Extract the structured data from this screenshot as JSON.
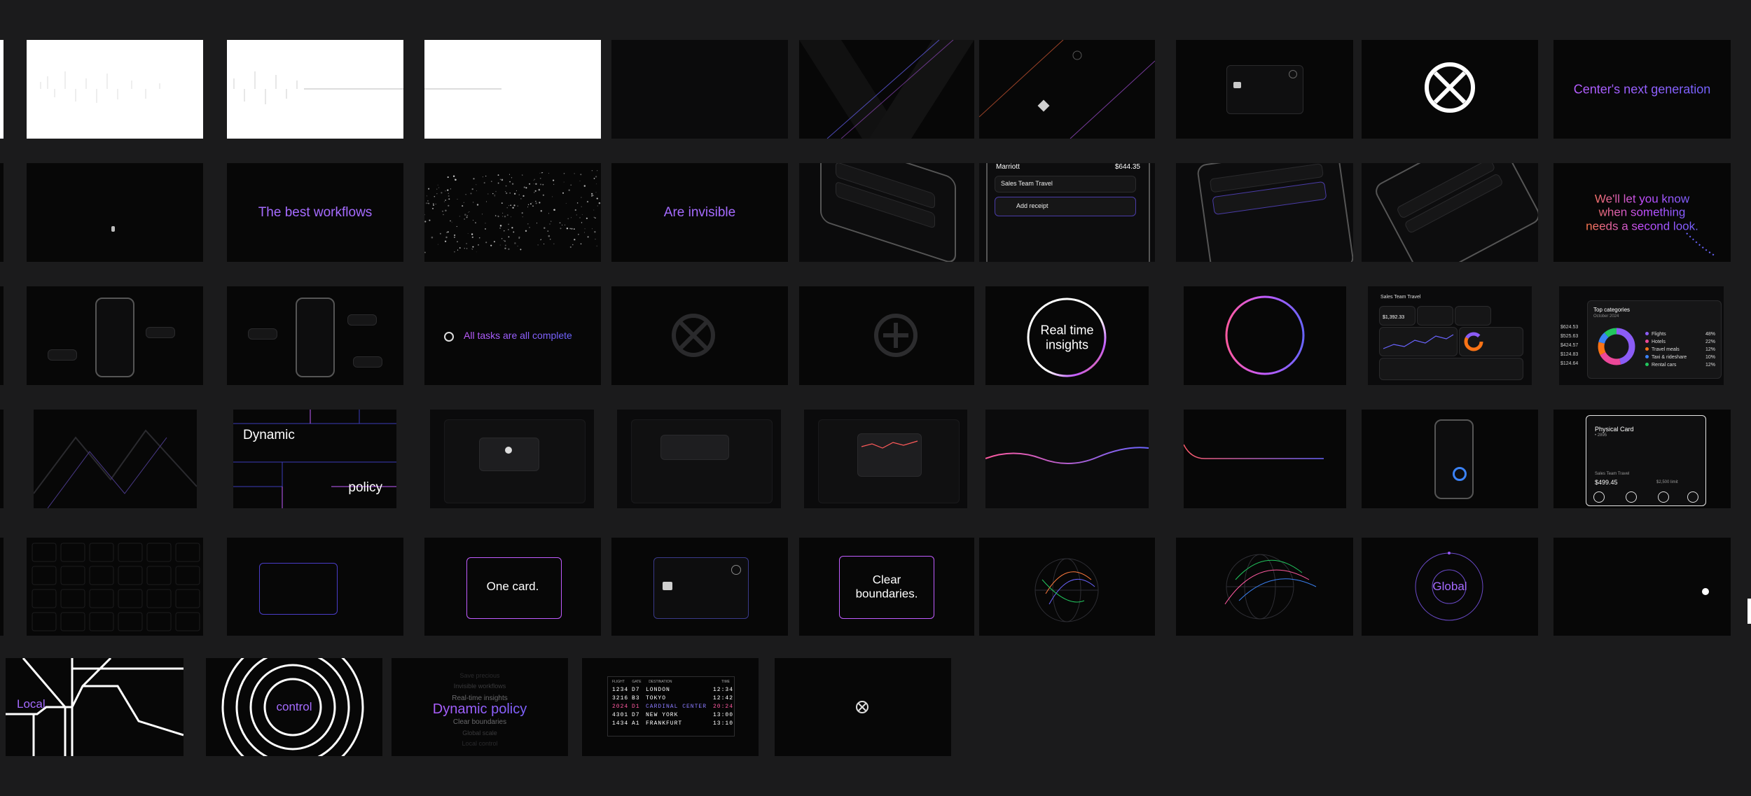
{
  "row1": {
    "headline": "Center's next generation"
  },
  "row2": {
    "best_workflows": "The best workflows",
    "are_invisible": "Are invisible",
    "let_you_know": "We'll let you know when something needs a second look.",
    "phone_amount": "$644.35",
    "phone_merchant": "Marriott",
    "phone_label_sales": "Sales Team Travel",
    "phone_add_receipt": "Add receipt"
  },
  "row3": {
    "all_tasks": "All tasks are all complete",
    "real_time": "Real time insights",
    "dashboard_title": "Sales Team Travel",
    "dashboard_total": "$1,392.33",
    "top_categories_title": "Top categories",
    "top_categories_sub": "October 2024",
    "category_amounts": [
      "$624.53",
      "$525.63",
      "$424.57",
      "$124.83",
      "$124.64"
    ],
    "categories": [
      {
        "name": "Flights",
        "pct": "48%",
        "color": "#8b5cf6"
      },
      {
        "name": "Hotels",
        "pct": "22%",
        "color": "#ec4899"
      },
      {
        "name": "Travel meals",
        "pct": "12%",
        "color": "#f97316"
      },
      {
        "name": "Taxi & rideshare",
        "pct": "10%",
        "color": "#3b82f6"
      },
      {
        "name": "Rental cars",
        "pct": "12%",
        "color": "#22c55e"
      }
    ]
  },
  "row4": {
    "dynamic": "Dynamic",
    "policy": "policy",
    "physical_card": "Physical Card",
    "card_suffix": "• 2895",
    "card_team": "Sales Team Travel",
    "card_amount": "$499.45",
    "card_limit": "$2,500 limit"
  },
  "row5": {
    "one_card": "One card.",
    "clear_boundaries": "Clear boundaries.",
    "global": "Global"
  },
  "row6": {
    "local": "Local",
    "control": "control",
    "word_stack_above": [
      "Save precious",
      "Invisible workflows",
      "Real-time insights"
    ],
    "word_stack_main": "Dynamic policy",
    "word_stack_below": [
      "Clear boundaries",
      "Global scale",
      "Local control"
    ],
    "board_headers": [
      "FLIGHT",
      "GATE",
      "DESTINATION",
      "TIME"
    ],
    "board_rows": [
      {
        "flight": "1234",
        "gate": "D7",
        "dest": "LONDON",
        "time": "12:34",
        "hl": false
      },
      {
        "flight": "3216",
        "gate": "B3",
        "dest": "TOKYO",
        "time": "12:42",
        "hl": false
      },
      {
        "flight": "2024",
        "gate": "D1",
        "dest": "CARDINAL CENTER",
        "time": "20:24",
        "hl": true
      },
      {
        "flight": "4301",
        "gate": "D7",
        "dest": "NEW YORK",
        "time": "13:00",
        "hl": false
      },
      {
        "flight": "1434",
        "gate": "A1",
        "dest": "FRANKFURT",
        "time": "13:10",
        "hl": false
      }
    ]
  },
  "colors": {
    "background": "#1b1b1c",
    "frame": "#070707",
    "accent_purple": "#9b59ff",
    "accent_blue": "#6a64ff",
    "accent_orange": "#ff7a3d",
    "accent_pink": "#ec4899"
  },
  "icons": [
    "brand-logo-icon",
    "card-chip-icon",
    "globe-icon",
    "ring-icon"
  ]
}
